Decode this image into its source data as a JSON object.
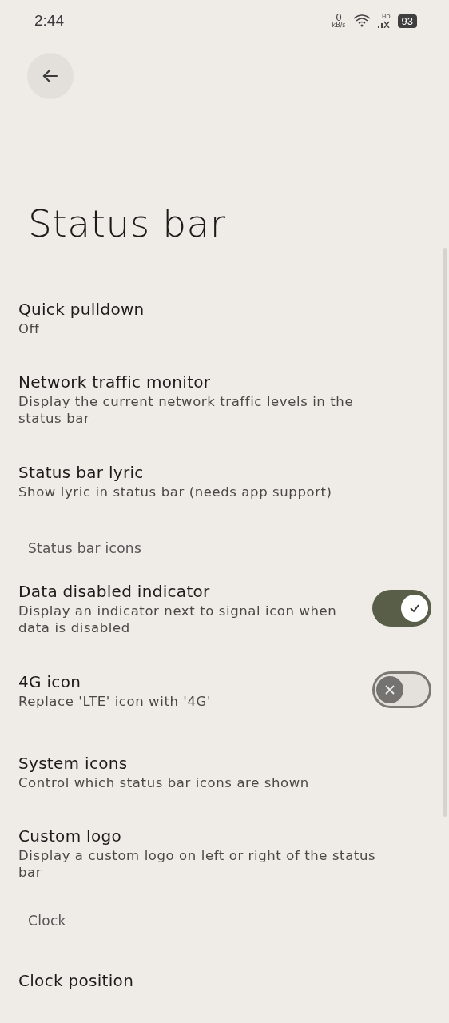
{
  "status_bar": {
    "time": "2:44",
    "net_speed": "0",
    "net_unit": "kB/s",
    "network_label": "HD",
    "battery": "93"
  },
  "title": "Status bar",
  "items": [
    {
      "kind": "item",
      "title": "Quick pulldown",
      "summary": "Off"
    },
    {
      "kind": "item",
      "title": "Network traffic monitor",
      "summary": "Display the current network traffic levels in the status bar"
    },
    {
      "kind": "item",
      "title": "Status bar lyric",
      "summary": "Show lyric in status bar (needs app support)"
    },
    {
      "kind": "header",
      "title": "Status bar icons"
    },
    {
      "kind": "switch",
      "title": "Data disabled indicator",
      "summary": "Display an indicator next to signal icon when data is disabled",
      "on": true
    },
    {
      "kind": "switch",
      "title": "4G icon",
      "summary": "Replace 'LTE' icon with '4G'",
      "on": false
    },
    {
      "kind": "item",
      "title": "System icons",
      "summary": "Control which status bar icons are shown"
    },
    {
      "kind": "item",
      "title": "Custom logo",
      "summary": "Display a custom logo on left or right of the status bar"
    },
    {
      "kind": "header",
      "title": "Clock"
    },
    {
      "kind": "item",
      "title": "Clock position"
    }
  ]
}
